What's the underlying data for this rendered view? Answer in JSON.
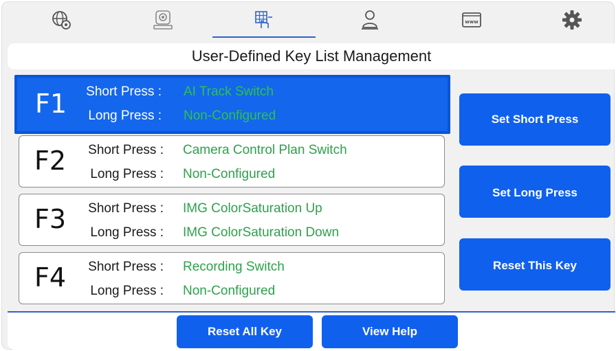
{
  "tabs": [
    {
      "icon": "globe-gear-icon"
    },
    {
      "icon": "camera-icon"
    },
    {
      "icon": "keypad-icon",
      "active": true
    },
    {
      "icon": "user-icon"
    },
    {
      "icon": "www-icon"
    },
    {
      "icon": "gear-icon"
    }
  ],
  "title": "User-Defined Key List Management",
  "labels": {
    "short": "Short Press :",
    "long": "Long Press :"
  },
  "keys": [
    {
      "name": "F1",
      "short": "AI Track Switch",
      "long": "Non-Configured",
      "selected": true
    },
    {
      "name": "F2",
      "short": "Camera Control Plan Switch",
      "long": "Non-Configured"
    },
    {
      "name": "F3",
      "short": "IMG ColorSaturation Up",
      "long": "IMG ColorSaturation Down"
    },
    {
      "name": "F4",
      "short": "Recording Switch",
      "long": "Non-Configured"
    }
  ],
  "buttons": {
    "set_short": "Set Short Press",
    "set_long": "Set Long Press",
    "reset_key": "Reset This Key",
    "reset_all": "Reset All Key",
    "view_help": "View Help"
  },
  "colors": {
    "accent": "#1060ee",
    "selected_card": "#1466ec",
    "value_text": "#2ca24a",
    "background": "#f1f1f1"
  }
}
